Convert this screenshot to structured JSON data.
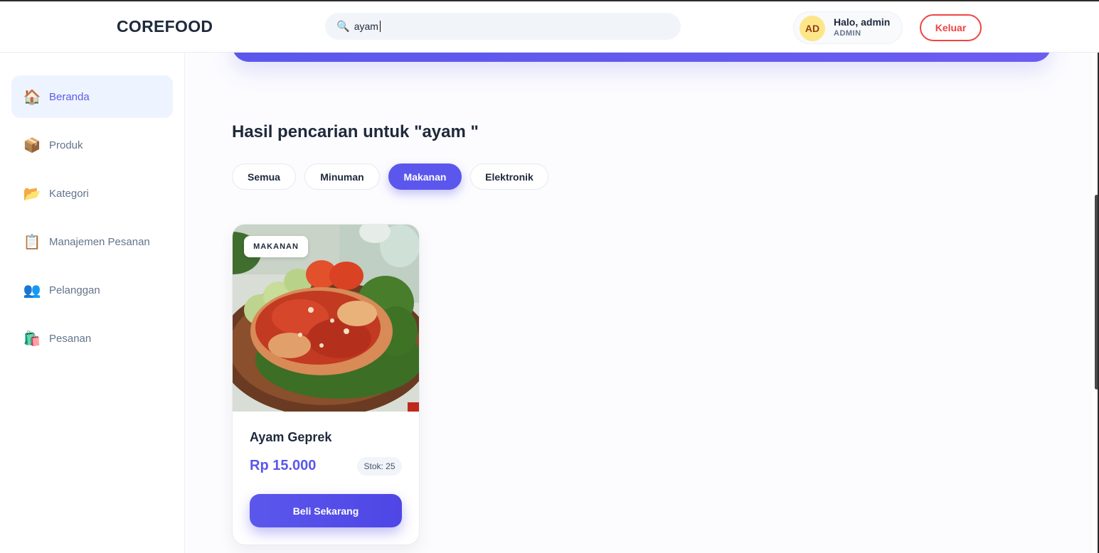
{
  "header": {
    "brand": "COREFOOD",
    "search": {
      "value": "ayam",
      "icon": "search-icon"
    },
    "user": {
      "initials": "AD",
      "greeting": "Halo, admin",
      "role": "ADMIN"
    },
    "logout_label": "Keluar"
  },
  "sidebar": {
    "items": [
      {
        "label": "Beranda",
        "icon": "🏠",
        "active": true
      },
      {
        "label": "Produk",
        "icon": "📦"
      },
      {
        "label": "Kategori",
        "icon": "📂"
      },
      {
        "label": "Manajemen Pesanan",
        "icon": "📋"
      },
      {
        "label": "Pelanggan",
        "icon": "👥"
      },
      {
        "label": "Pesanan",
        "icon": "🛍️"
      }
    ]
  },
  "main": {
    "result_title": "Hasil pencarian untuk \"ayam \"",
    "filters": [
      {
        "label": "Semua"
      },
      {
        "label": "Minuman"
      },
      {
        "label": "Makanan",
        "active": true
      },
      {
        "label": "Elektronik"
      }
    ],
    "products": [
      {
        "category_badge": "MAKANAN",
        "name": "Ayam Geprek",
        "price": "Rp 15.000",
        "stock": "Stok: 25",
        "buy_label": "Beli Sekarang"
      }
    ]
  },
  "colors": {
    "accent": "#5b57ec",
    "danger": "#ef4444",
    "avatar_bg": "#fde68a"
  }
}
